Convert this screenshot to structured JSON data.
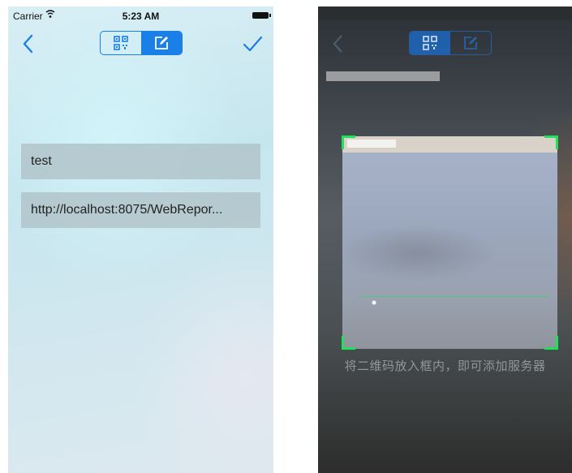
{
  "left_screen": {
    "status_bar": {
      "carrier": "Carrier",
      "time": "5:23 AM"
    },
    "nav": {
      "back_icon": "chevron-left-icon",
      "confirm_icon": "checkmark-icon",
      "segment": {
        "options": [
          "qr-code-icon",
          "edit-icon"
        ],
        "selected": "edit-icon"
      }
    },
    "fields": {
      "name_value": "test",
      "url_value": "http://localhost:8075/WebRepor..."
    }
  },
  "right_screen": {
    "nav": {
      "back_icon": "chevron-left-icon",
      "segment": {
        "selected": "qr-code-icon"
      }
    },
    "scan_hint": "将二维码放入框内，即可添加服务器"
  },
  "colors": {
    "accent": "#1a7fe6",
    "scan_corner": "#1ee35a",
    "field_bg": "#b2c4ca"
  }
}
